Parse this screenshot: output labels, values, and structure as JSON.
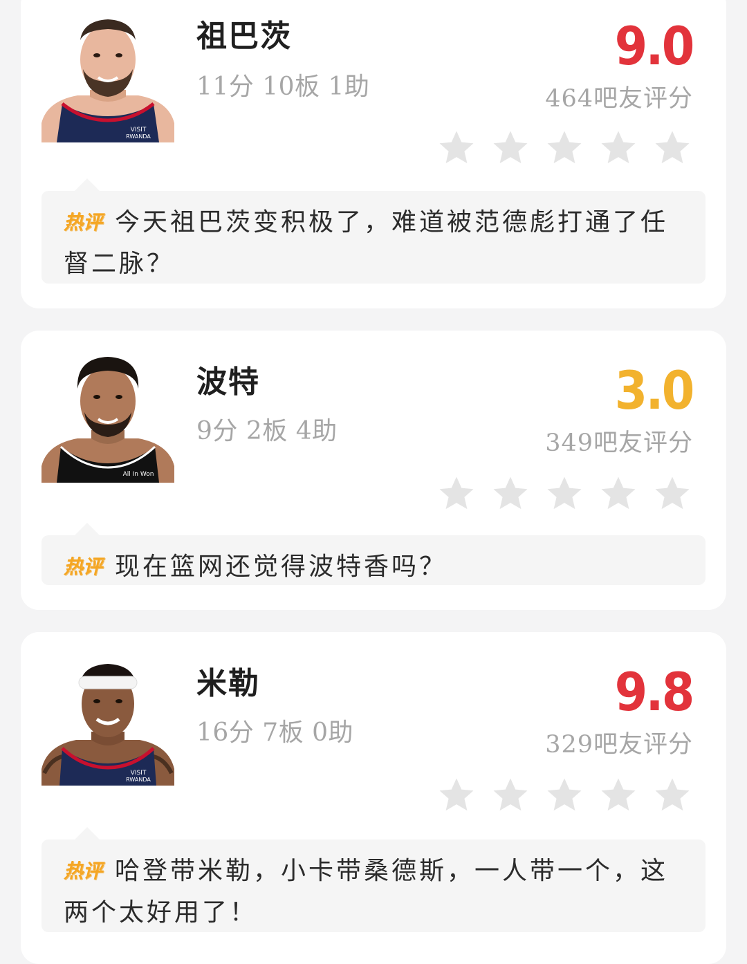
{
  "hot_tag": "热评",
  "players": [
    {
      "name": "祖巴茨",
      "stats": "11分 10板 1助",
      "score": "9.0",
      "score_color": "#e2333b",
      "votes": "464吧友评分",
      "star_count": 5,
      "comment": "今天祖巴茨变积极了，难道被范德彪打通了任督二脉？",
      "jersey_color": "#1d2a56",
      "jersey_text": "VISIT RWANDA"
    },
    {
      "name": "波特",
      "stats": "9分 2板 4助",
      "score": "3.0",
      "score_color": "#f2b22e",
      "votes": "349吧友评分",
      "star_count": 5,
      "comment": "现在篮网还觉得波特香吗？",
      "jersey_color": "#111111",
      "jersey_text": "All In Won"
    },
    {
      "name": "米勒",
      "stats": "16分 7板 0助",
      "score": "9.8",
      "score_color": "#e2333b",
      "votes": "329吧友评分",
      "star_count": 5,
      "comment": "哈登带米勒，小卡带桑德斯，一人带一个，这两个太好用了！",
      "jersey_color": "#1d2a56",
      "jersey_text": "VISIT RWANDA"
    }
  ]
}
